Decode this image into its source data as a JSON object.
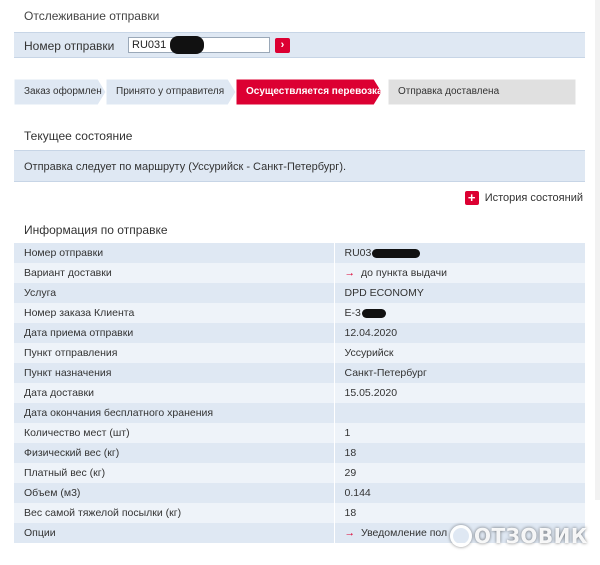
{
  "page_title": "Отслеживание отправки",
  "tracking": {
    "label": "Номер отправки",
    "value": "RU031"
  },
  "steps": [
    {
      "label": "Заказ оформлен",
      "state": "done"
    },
    {
      "label": "Принято у отправителя",
      "state": "done"
    },
    {
      "label": "Осуществляется перевозка",
      "state": "active"
    },
    {
      "label": "Отправка доставлена",
      "state": "pending"
    }
  ],
  "status": {
    "title": "Текущее состояние",
    "text": "Отправка следует по маршруту (Уссурийск - Санкт-Петербург)."
  },
  "history_link": "История состояний",
  "info": {
    "title": "Информация по отправке",
    "rows": [
      {
        "label": "Номер отправки",
        "value": "RU03"
      },
      {
        "label": "Вариант доставки",
        "value": "до пункта выдачи",
        "arrow": true
      },
      {
        "label": "Услуга",
        "value": "DPD ECONOMY"
      },
      {
        "label": "Номер заказа Клиента",
        "value": "Е-3"
      },
      {
        "label": "Дата приема отправки",
        "value": "12.04.2020"
      },
      {
        "label": "Пункт отправления",
        "value": "Уссурийск"
      },
      {
        "label": "Пункт назначения",
        "value": "Санкт-Петербург"
      },
      {
        "label": "Дата доставки",
        "value": "15.05.2020"
      },
      {
        "label": "Дата окончания бесплатного хранения",
        "value": ""
      },
      {
        "label": "Количество мест (шт)",
        "value": "1"
      },
      {
        "label": "Физический вес (кг)",
        "value": "18"
      },
      {
        "label": "Платный вес (кг)",
        "value": "29"
      },
      {
        "label": "Объем (м3)",
        "value": "0.144"
      },
      {
        "label": "Вес самой тяжелой посылки (кг)",
        "value": "18"
      },
      {
        "label": "Опции",
        "value": "Уведомление пол",
        "arrow": true
      }
    ]
  },
  "watermark": "ОТЗОВИК",
  "colors": {
    "accent": "#dc0032",
    "row_dark": "#dfe8f3",
    "row_light": "#eef3f9",
    "step_done": "#dfe8f3",
    "step_pending": "#e0e0e0"
  }
}
